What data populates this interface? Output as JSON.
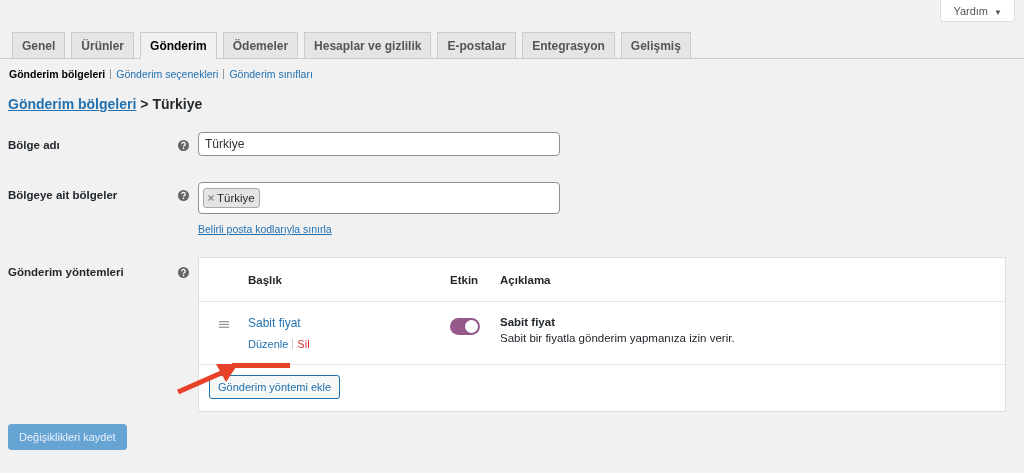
{
  "help_button": {
    "label": "Yardım",
    "caret": "▼"
  },
  "tabs": [
    {
      "label": "Genel",
      "selected": false
    },
    {
      "label": "Ürünler",
      "selected": false
    },
    {
      "label": "Gönderim",
      "selected": true
    },
    {
      "label": "Ödemeler",
      "selected": false
    },
    {
      "label": "Hesaplar ve gizlilik",
      "selected": false
    },
    {
      "label": "E-postalar",
      "selected": false
    },
    {
      "label": "Entegrasyon",
      "selected": false
    },
    {
      "label": "Gelişmiş",
      "selected": false
    }
  ],
  "subnav": [
    {
      "label": "Gönderim bölgeleri",
      "selected": true
    },
    {
      "label": "Gönderim seçenekleri",
      "selected": false
    },
    {
      "label": "Gönderim sınıfları",
      "selected": false
    }
  ],
  "heading": {
    "link": "Gönderim bölgeleri",
    "rest": "> Türkiye"
  },
  "zone_name": {
    "label": "Bölge adı",
    "value": "Türkiye"
  },
  "zone_regions": {
    "label": "Bölgeye ait bölgeler",
    "tags": [
      "Türkiye"
    ],
    "link": "Belirli posta kodlarıyla sınırla"
  },
  "methods": {
    "label": "Gönderim yöntemleri",
    "columns": [
      "Başlık",
      "Etkin",
      "Açıklama"
    ],
    "rows": [
      {
        "title": "Sabit fiyat",
        "edit": "Düzenle",
        "delete": "Sil",
        "enabled": true,
        "desc_title": "Sabit fiyat",
        "description": "Sabit bir fiyatla gönderim yapmanıza izin verir."
      }
    ],
    "add_button": "Gönderim yöntemi ekle"
  },
  "save_button": {
    "label": "Değişiklikleri kaydet",
    "disabled": true
  }
}
